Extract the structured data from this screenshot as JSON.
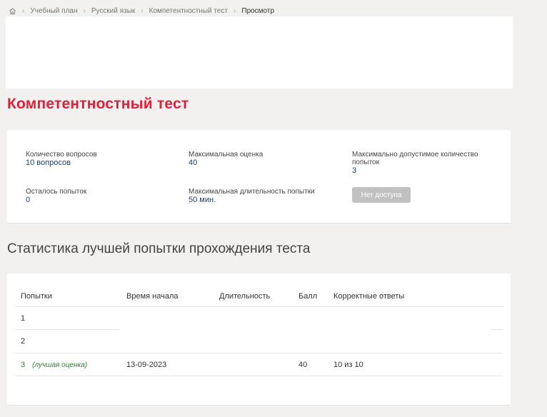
{
  "breadcrumb": {
    "items": [
      "Учебный план",
      "Русский язык",
      "Компетентностный тест"
    ],
    "current": "Просмотр"
  },
  "page_title": "Компетентностный тест",
  "info": {
    "questions_label": "Количество вопросов",
    "questions_value": "10 вопросов",
    "max_score_label": "Максимальная оценка",
    "max_score_value": "40",
    "max_attempts_label": "Максимально допустимое количество попыток",
    "max_attempts_value": "3",
    "attempts_left_label": "Осталось попыток",
    "attempts_left_value": "0",
    "max_duration_label": "Максимальная длительность попытки",
    "max_duration_value": "50 мин.",
    "no_access_label": "Нет доступа"
  },
  "stats": {
    "title": "Статистика лучшей попытки прохождения теста",
    "headers": [
      "Попытки",
      "Время начала",
      "Длительность",
      "Балл",
      "Корректные ответы"
    ],
    "rows": [
      {
        "attempt": "1",
        "best": "",
        "start": "",
        "duration": "",
        "score": "",
        "correct": ""
      },
      {
        "attempt": "2",
        "best": "",
        "start": "",
        "duration": "",
        "score": "",
        "correct": ""
      },
      {
        "attempt": "3",
        "best": "(лучшая оценка)",
        "start": "13-09-2023",
        "duration": "",
        "score": "40",
        "correct": "10 из 10"
      }
    ]
  },
  "colors": {
    "accent": "#e0203a",
    "value_text": "#1d3f66",
    "best_label": "#2e7d32",
    "disabled_button": "#c1c1c1"
  }
}
